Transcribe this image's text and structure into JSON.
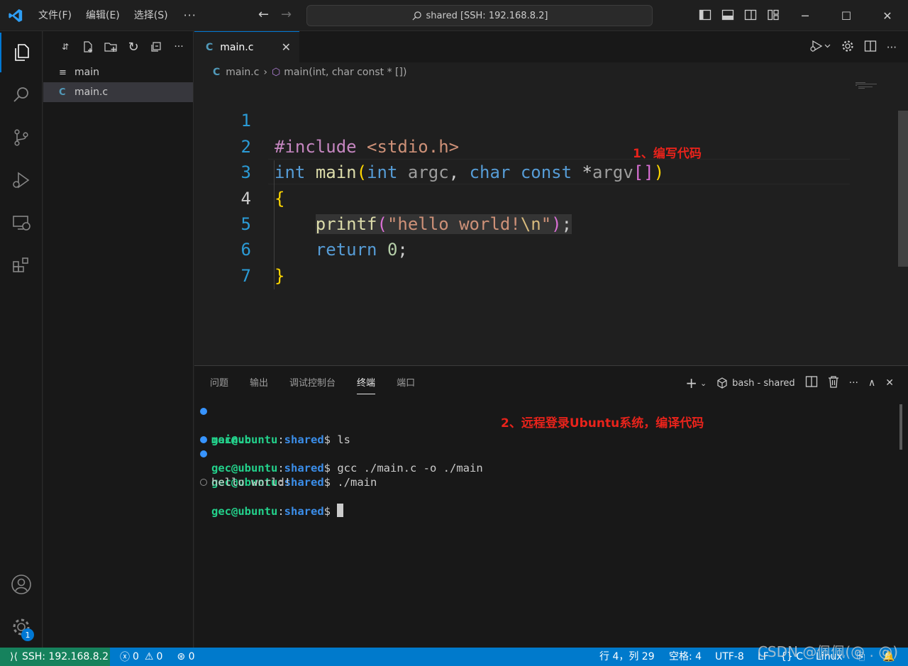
{
  "titlebar": {
    "menus": [
      "文件(F)",
      "编辑(E)",
      "选择(S)"
    ],
    "more": "···",
    "command_center": "shared [SSH: 192.168.8.2]"
  },
  "activity_bar": {
    "items": [
      "explorer-icon",
      "search-icon",
      "source-control-icon",
      "run-debug-icon",
      "remote-explorer-icon",
      "extensions-icon"
    ],
    "bottom": [
      "account-icon",
      "manage-gear-icon"
    ],
    "gear_badge": "1"
  },
  "sidebar": {
    "toolbar_more": "···",
    "files": [
      {
        "name": "main",
        "icon": "≡"
      },
      {
        "name": "main.c",
        "icon": "C"
      }
    ]
  },
  "editor": {
    "tab_label": "main.c",
    "tab_icon": "C",
    "breadcrumb_file": "main.c",
    "breadcrumb_symbol": "main(int, char const * [])",
    "line_numbers": [
      "1",
      "2",
      "3",
      "4",
      "5",
      "6",
      "7"
    ],
    "code": {
      "l1_pre": "#include ",
      "l1_inc": "<stdio.h>",
      "l2_int": "int",
      "l2_main": "main",
      "l2_int2": "int",
      "l2_argc": "argc",
      "l2_char": "char",
      "l2_const": "const",
      "l2_argv": "argv",
      "l3": "{",
      "l4_fn": "printf",
      "l4_str": "\"hello world!",
      "l4_esc": "\\n",
      "l4_strend": "\"",
      "l5_ret": "return",
      "l5_num": "0",
      "l6": "}"
    },
    "annotation": "1、编写代码"
  },
  "panel": {
    "tabs": [
      "问题",
      "输出",
      "调试控制台",
      "终端",
      "端口"
    ],
    "active_tab": "终端",
    "terminal_name": "bash - shared",
    "prompt_user": "gec@ubuntu",
    "prompt_path": "shared",
    "lines": [
      {
        "cmd": " ls"
      },
      {
        "out": "main.c"
      },
      {
        "cmd": " gcc ./main.c -o ./main"
      },
      {
        "cmd": " ./main"
      },
      {
        "out": "hello world!"
      },
      {
        "cmd": " "
      }
    ],
    "annotation": "2、远程登录Ubuntu系统，编译代码"
  },
  "statusbar": {
    "remote": "SSH: 192.168.8.2",
    "errors": "0",
    "warnings": "0",
    "ports": "0",
    "position": "行 4，列 29",
    "spaces": "空格: 4",
    "encoding": "UTF-8",
    "eol": "LF",
    "language": "C",
    "platform": "Linux"
  },
  "watermark": "CSDN @佩佩(@ . @)",
  "colors": {
    "accent": "#0078d4",
    "statusbar": "#007acc",
    "remote": "#16825d",
    "annotation": "#e8231b"
  }
}
